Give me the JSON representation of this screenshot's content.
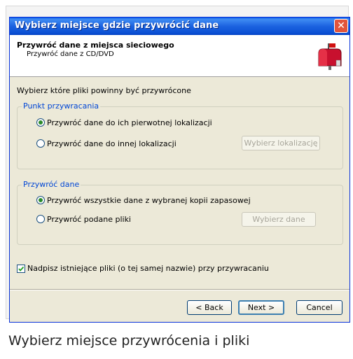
{
  "window": {
    "title": "Wybierz miejsce gdzie przywrócić dane",
    "close_glyph": "✕"
  },
  "header": {
    "title": "Przywróć dane z miejsca sieciowego",
    "subtitle": "Przywróć dane z CD/DVD",
    "icon": "mailbox-icon"
  },
  "instruction": "Wybierz które pliki powinny być przywrócone",
  "restore_point": {
    "legend": "Punkt przywracania",
    "options": [
      {
        "label": "Przywróć dane do ich pierwotnej lokalizacji",
        "checked": true
      },
      {
        "label": "Przywróć dane do innej lokalizacji",
        "checked": false
      }
    ],
    "choose_location_button": "Wybierz lokalizację"
  },
  "restore_data": {
    "legend": "Przywróć dane",
    "options": [
      {
        "label": "Przywróć wszystkie dane z wybranej kopii zapasowej",
        "checked": true
      },
      {
        "label": "Przywróć podane pliki",
        "checked": false
      }
    ],
    "choose_data_button": "Wybierz dane"
  },
  "overwrite": {
    "label": "Nadpisz istniejące pliki (o tej samej nazwie) przy przywracaniu",
    "checked": true
  },
  "footer": {
    "back": "< Back",
    "next": "Next >",
    "cancel": "Cancel"
  },
  "caption": "Wybierz miejsce przywrócenia i pliki",
  "colors": {
    "titlebar": "#0a4fd3",
    "dialog_bg": "#ece9d8",
    "legend_text": "#0046d5",
    "close_button": "#e2553b"
  }
}
